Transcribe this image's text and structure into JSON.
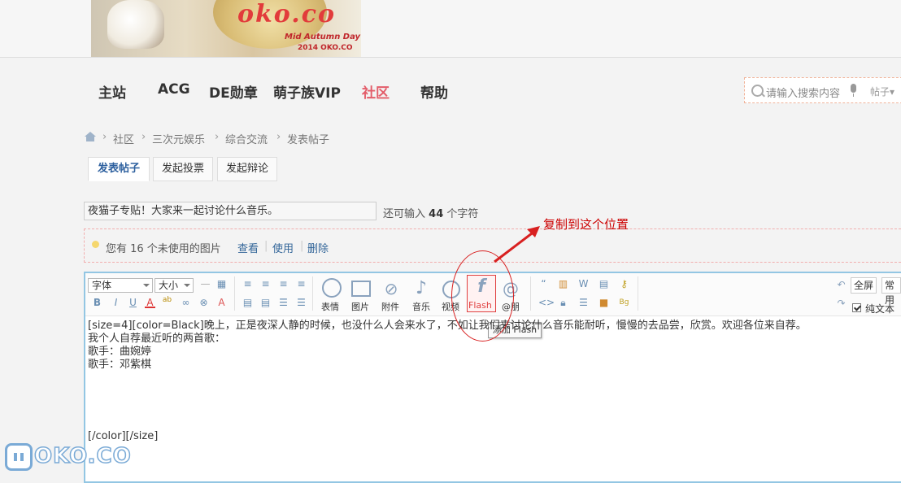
{
  "banner": {
    "logo_text": "oko.co",
    "tag_line1": "Mid Autumn Day",
    "tag_line2": "2014 OKO.CO"
  },
  "nav": {
    "items": [
      "主站",
      "ACG",
      "DE勋章",
      "萌子族VIP",
      "社区",
      "帮助"
    ],
    "active": "社区"
  },
  "search": {
    "placeholder": "请输入搜索内容",
    "category": "帖子▾"
  },
  "breadcrumb": {
    "items": [
      "社区",
      "三次元娱乐",
      "综合交流",
      "发表帖子"
    ]
  },
  "tabs": [
    "发表帖子",
    "发起投票",
    "发起辩论"
  ],
  "subject": {
    "value": "夜猫子专贴！大家来一起讨论什么音乐。",
    "remaining_prefix": "还可输入",
    "remaining_count": "44",
    "remaining_suffix": "个字符"
  },
  "notice": {
    "text": "您有 16 个未使用的图片",
    "links": [
      "查看",
      "使用",
      "删除"
    ]
  },
  "annotation": {
    "text": "复制到这个位置",
    "color": "#cc0000"
  },
  "toolbar": {
    "font_select": "字体",
    "size_select": "大小",
    "insert_buttons": [
      "表情",
      "图片",
      "附件",
      "音乐",
      "视频",
      "Flash",
      "@朋"
    ],
    "tooltip": "添加 Flash",
    "fullscreen": "全屏",
    "common": "常用",
    "plain_text_label": "纯文本",
    "plain_text_checked": true
  },
  "editor": {
    "lines": [
      "[size=4][color=Black]晚上，正是夜深人静的时候，也没什么人会来水了，不如让我们来讨论什么音乐能耐听，慢慢的去品尝，欣赏。欢迎各位来自荐。",
      "我个人自荐最近听的两首歌：",
      "歌手：曲婉婷",
      "歌手：邓紫棋"
    ],
    "closing": "[/color][/size]"
  },
  "watermark": {
    "text": "OKO.CO"
  },
  "colors": {
    "accent": "#e35d6a",
    "link": "#336699",
    "editor_border": "#93c6e3",
    "watermark": "#7aaad6"
  }
}
